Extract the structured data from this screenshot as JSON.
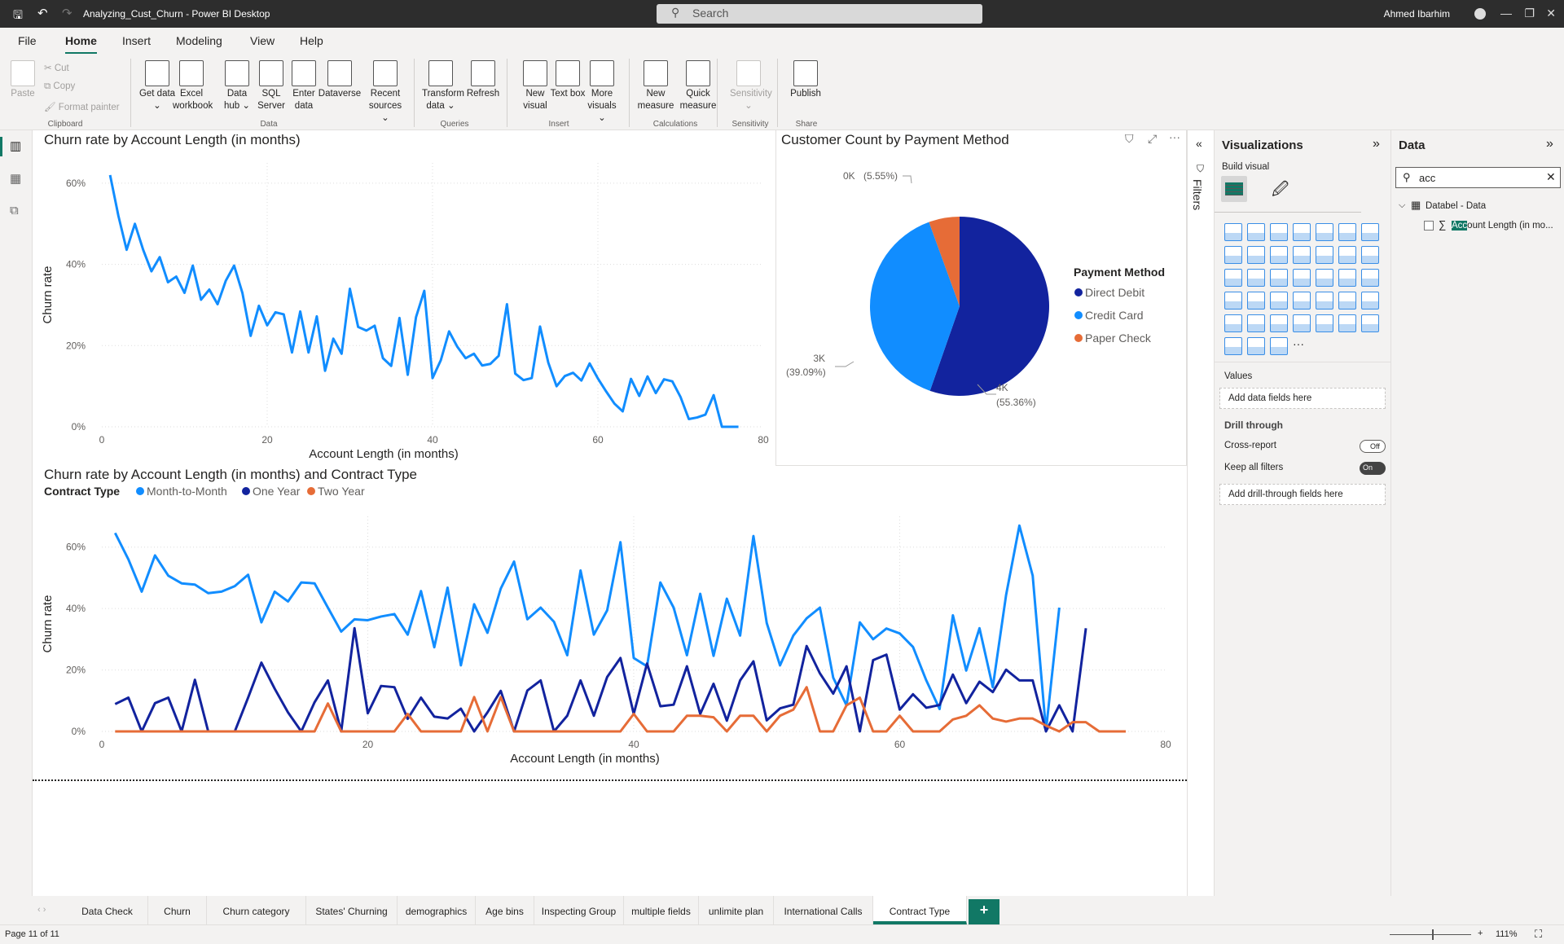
{
  "app": {
    "title": "Analyzing_Cust_Churn - Power BI Desktop",
    "search_placeholder": "Search",
    "user": "Ahmed Ibarhim"
  },
  "menu": [
    "File",
    "Home",
    "Insert",
    "Modeling",
    "View",
    "Help"
  ],
  "ribbon": {
    "clipboard": {
      "paste": "Paste",
      "cut": "Cut",
      "copy": "Copy",
      "format_painter": "Format painter",
      "group": "Clipboard"
    },
    "buttons": [
      {
        "label": "Get data ⌄",
        "x": 0,
        "group": "Data"
      },
      {
        "label": "Excel workbook"
      },
      {
        "label": "Data hub ⌄"
      },
      {
        "label": "SQL Server"
      },
      {
        "label": "Enter data"
      },
      {
        "label": "Dataverse"
      },
      {
        "label": "Recent sources ⌄"
      },
      {
        "label": "Transform data ⌄"
      },
      {
        "label": "Refresh"
      },
      {
        "label": "New visual"
      },
      {
        "label": "Text box"
      },
      {
        "label": "More visuals ⌄"
      },
      {
        "label": "New measure"
      },
      {
        "label": "Quick measure"
      },
      {
        "label": "Sensitivity ⌄"
      },
      {
        "label": "Publish"
      }
    ],
    "groups": [
      "Data",
      "Queries",
      "Insert",
      "Calculations",
      "Sensitivity",
      "Share"
    ]
  },
  "visuals": {
    "top_line": {
      "title": "Churn rate by Account Length (in months)"
    },
    "pie": {
      "title": "Customer Count by Payment Method"
    },
    "bottom_line": {
      "title": "Churn rate by Account Length (in months) and Contract Type"
    }
  },
  "chart_data": [
    {
      "type": "line",
      "title": "Churn rate by Account Length (in months)",
      "xlabel": "Account Length (in months)",
      "ylabel": "Churn rate",
      "xlim": [
        0,
        80
      ],
      "ylim": [
        0,
        65
      ],
      "xticks": [
        "0",
        "20",
        "40",
        "60",
        "80"
      ],
      "yticks": [
        "0%",
        "20%",
        "40%",
        "60%"
      ],
      "grid": true,
      "color": "#118dff",
      "x_start": 1,
      "values": [
        62,
        52,
        43.6,
        50,
        43.6,
        38.3,
        41.8,
        35.6,
        37,
        33,
        39.7,
        31.3,
        33.8,
        30.2,
        36,
        39.7,
        33,
        22.4,
        29.8,
        25,
        28.2,
        27.7,
        18.3,
        28.4,
        18.3,
        27.2,
        13.8,
        21.7,
        18,
        34,
        24.6,
        23.7,
        24.9,
        16.9,
        15,
        26.8,
        12.8,
        27,
        33.5,
        12,
        16.4,
        23.5,
        19.7,
        16.9,
        18,
        15.1,
        15.5,
        17.5,
        30.2,
        13.1,
        11.5,
        12,
        24.7,
        15.8,
        10,
        12.5,
        13.3,
        11.4,
        15.6,
        11.9,
        8.7,
        5.7,
        3.8,
        11.8,
        7.6,
        12.4,
        8.3,
        11.7,
        11.2,
        7.3,
        1.9,
        2.3,
        3,
        7.8,
        0,
        0,
        0
      ]
    },
    {
      "type": "pie",
      "title": "Customer Count by Payment Method",
      "legend_title": "Payment Method",
      "legend_position": "right",
      "slices": [
        {
          "name": "Direct Debit",
          "percent": 55.36,
          "label": "4K",
          "pct_label": "(55.36%)",
          "color": "#12239e"
        },
        {
          "name": "Credit Card",
          "percent": 39.09,
          "label": "3K",
          "pct_label": "(39.09%)",
          "color": "#118dff"
        },
        {
          "name": "Paper Check",
          "percent": 5.55,
          "label": "0K",
          "pct_label": "(5.55%)",
          "color": "#e66c37"
        }
      ]
    },
    {
      "type": "line",
      "title": "Churn rate by Account Length (in months) and Contract Type",
      "legend_title": "Contract Type",
      "legend_position": "top-left",
      "xlabel": "Account Length (in months)",
      "ylabel": "Churn rate",
      "xlim": [
        0,
        80
      ],
      "ylim": [
        0,
        70
      ],
      "xticks": [
        "0",
        "20",
        "40",
        "60",
        "80"
      ],
      "yticks": [
        "0%",
        "20%",
        "40%",
        "60%"
      ],
      "grid": true,
      "x_start": 1,
      "series": [
        {
          "name": "Month-to-Month",
          "color": "#118dff",
          "values": [
            64.6,
            56,
            45.5,
            57.3,
            50.7,
            48.2,
            47.8,
            45,
            45.5,
            47.3,
            51,
            35.5,
            45.5,
            42.3,
            48.5,
            48.2,
            40.3,
            32.5,
            36.5,
            36.2,
            37.4,
            38.2,
            31.5,
            45.7,
            27.4,
            46.8,
            21.5,
            41.4,
            32.1,
            46.5,
            55.3,
            36.5,
            40.3,
            35.7,
            24.8,
            52.4,
            31.5,
            39.4,
            61.6,
            23.9,
            21.2,
            48.5,
            40.3,
            24.8,
            44.8,
            24.6,
            43.2,
            31.2,
            63.6,
            35.3,
            21.5,
            31.2,
            36.8,
            40.3,
            17.5,
            8.5,
            35.5,
            30,
            33.5,
            31.9,
            27.5,
            16.6,
            7.3,
            37.8,
            19.8,
            33.6,
            14.4,
            44.4,
            67,
            50.7,
            0.3,
            40.3
          ]
        },
        {
          "name": "One Year",
          "color": "#12239e",
          "values": [
            8.9,
            11,
            0,
            9.2,
            11,
            0,
            16.8,
            0,
            0,
            0,
            11,
            22.4,
            13.9,
            6.2,
            0,
            9.5,
            16.6,
            0,
            33.6,
            5.9,
            14.8,
            14.4,
            4.1,
            11,
            4.8,
            4.2,
            7.4,
            0,
            6.2,
            13.2,
            0,
            13.3,
            16.6,
            0,
            5.1,
            16.6,
            5.1,
            17.7,
            23.9,
            5.7,
            22.1,
            8.2,
            8.7,
            21.2,
            5.7,
            15.5,
            3.5,
            16.6,
            22.8,
            3.6,
            7.5,
            8.7,
            27.8,
            18.9,
            12.3,
            21.2,
            0,
            23.2,
            25,
            7.1,
            12.1,
            7.7,
            8.6,
            18.5,
            9.2,
            16.2,
            12.8,
            20.1,
            16.6,
            16.6,
            0,
            8.5,
            0,
            33.6
          ]
        },
        {
          "name": "Two Year",
          "color": "#e66c37",
          "values": [
            0,
            0,
            0,
            0,
            0,
            0,
            0,
            0,
            0,
            0,
            0,
            0,
            0,
            0,
            0,
            0,
            9.1,
            0,
            0,
            0,
            0,
            0,
            5.7,
            0,
            0,
            0,
            0,
            11.2,
            0,
            11.2,
            0,
            0,
            0,
            0,
            0,
            0,
            0,
            0,
            0,
            5.7,
            0,
            0,
            0,
            5.1,
            5.1,
            4.6,
            0,
            5.1,
            5.1,
            0,
            5.1,
            7.1,
            14.4,
            0,
            0,
            8.5,
            11,
            0,
            0,
            5.1,
            0,
            0,
            0,
            3.9,
            5.1,
            8.5,
            4.2,
            3.2,
            4.2,
            4.2,
            1.9,
            0,
            3,
            3,
            0,
            0,
            0
          ]
        }
      ]
    }
  ],
  "filters_label": "Filters",
  "viz_pane": {
    "title": "Visualizations",
    "build_visual": "Build visual",
    "values_label": "Values",
    "values_well": "Add data fields here",
    "drill_through": "Drill through",
    "cross_report": "Cross-report",
    "cross_report_state": "Off",
    "keep_filters": "Keep all filters",
    "keep_filters_state": "On",
    "drill_well": "Add drill-through fields here",
    "more": "···"
  },
  "data_pane": {
    "title": "Data",
    "search_value": "acc",
    "table": "Databel - Data",
    "field_highlight": "Acc",
    "field_rest": "ount Length (in mo..."
  },
  "tabs": [
    "Data Check",
    "Churn",
    "Churn category",
    "States' Churning",
    "demographics",
    "Age bins",
    "Inspecting Group",
    "multiple fields",
    "unlimite plan",
    "International Calls",
    "Contract Type"
  ],
  "active_tab": "Contract Type",
  "status": {
    "page": "Page 11 of 11",
    "zoom": "111%"
  },
  "colors": {
    "accent": "#117865",
    "blue": "#118dff",
    "navy": "#12239e",
    "orange": "#e66c37"
  }
}
